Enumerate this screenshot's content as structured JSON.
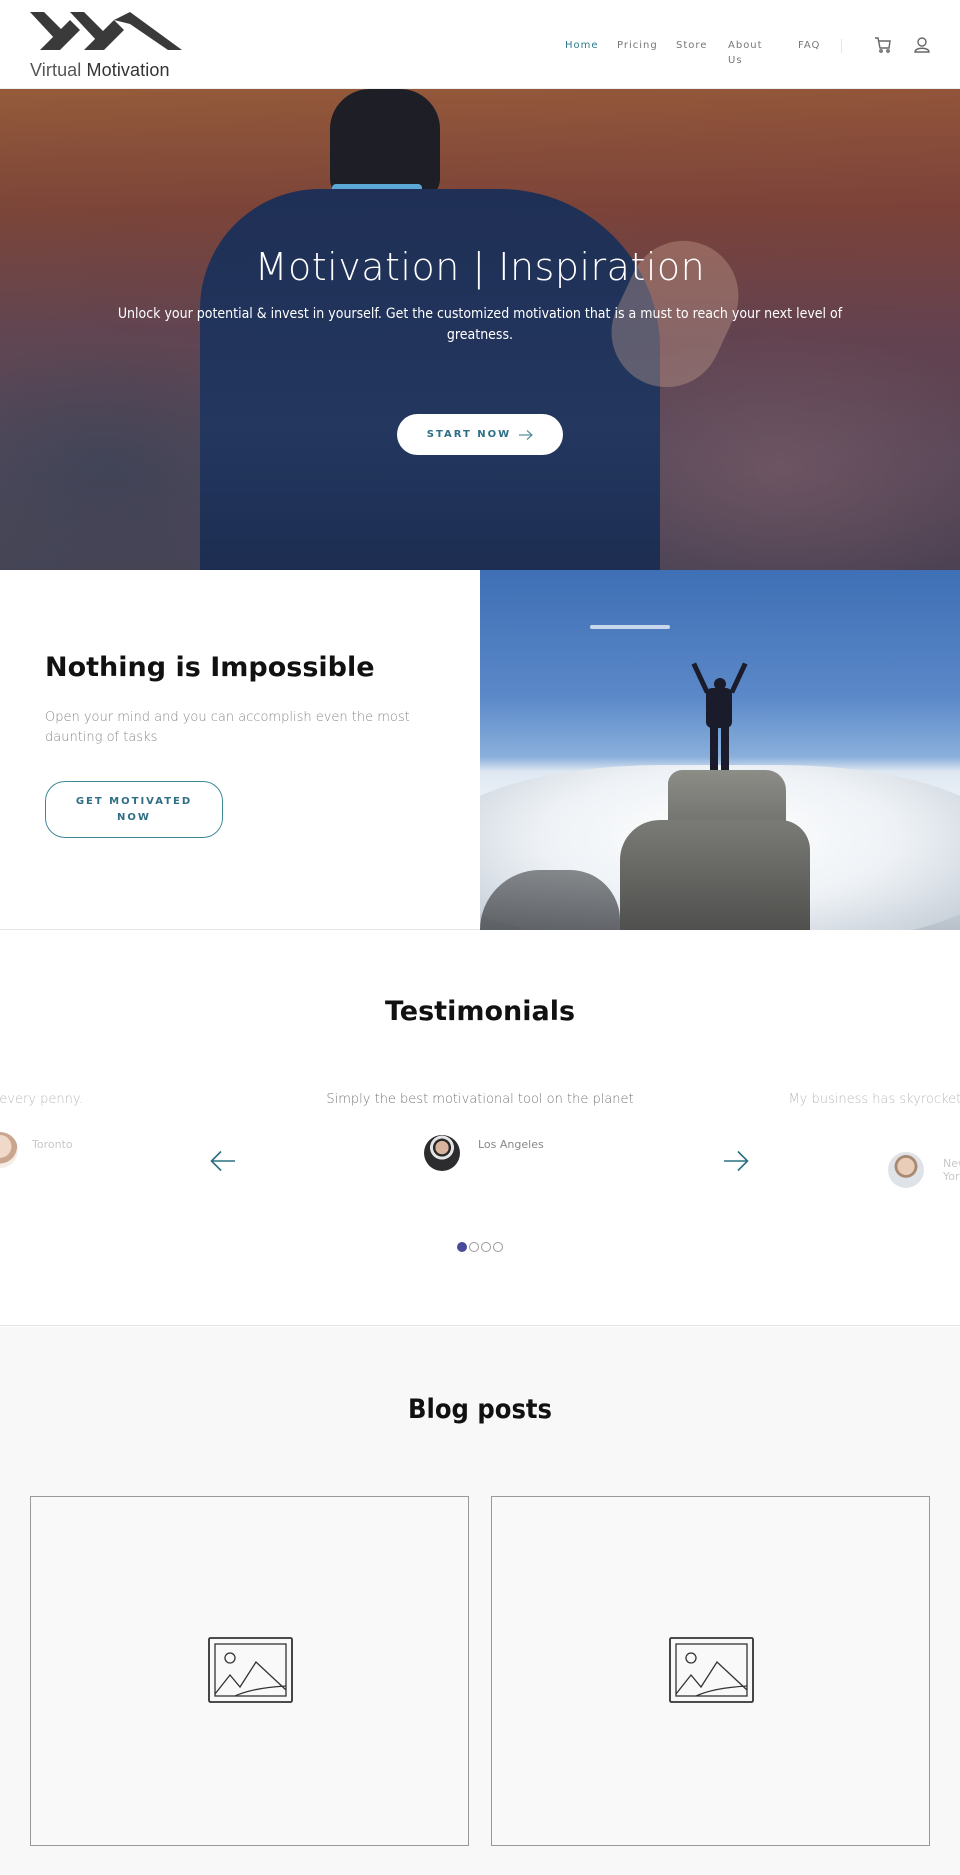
{
  "header": {
    "logo": {
      "text_light": "Virtual",
      "text_bold": "Motivation",
      "icon": "vm-logo-icon"
    },
    "nav": [
      {
        "label": "Home",
        "active": true
      },
      {
        "label": "Pricing",
        "active": false
      },
      {
        "label": "Store",
        "active": false
      },
      {
        "label": "About Us",
        "active": false
      },
      {
        "label": "FAQ",
        "active": false
      }
    ],
    "icons": {
      "cart": "cart-icon",
      "account": "user-icon"
    },
    "accent_color": "#2f7d8c"
  },
  "hero": {
    "title": "Motivation | Inspiration",
    "subtitle": "Unlock your potential & invest in yourself. Get the customized motivation that is a must to reach your next level of greatness.",
    "button_label": "START NOW",
    "button_icon": "arrow-right-icon"
  },
  "feature": {
    "title": "Nothing is Impossible",
    "description": "Open your mind and you can accomplish even the most daunting of tasks",
    "button_label": "GET MOTIVATED NOW"
  },
  "testimonials": {
    "title": "Testimonials",
    "items": [
      {
        "quote": "Amazing! Worth every penny.",
        "location": "Toronto",
        "state": "previous"
      },
      {
        "quote": "Simply the best motivational tool on the planet",
        "location": "Los Angeles",
        "state": "current"
      },
      {
        "quote": "My business has skyrocketed after Virtual Motivation",
        "location": "New York",
        "state": "next"
      }
    ],
    "prev_icon": "arrow-left-icon",
    "next_icon": "arrow-right-icon",
    "pagination": {
      "total": 4,
      "active": 1
    },
    "dot_color": "#4a4a9a"
  },
  "blog": {
    "title": "Blog posts",
    "posts": [
      {
        "image": "image-placeholder-icon"
      },
      {
        "image": "image-placeholder-icon"
      }
    ]
  }
}
